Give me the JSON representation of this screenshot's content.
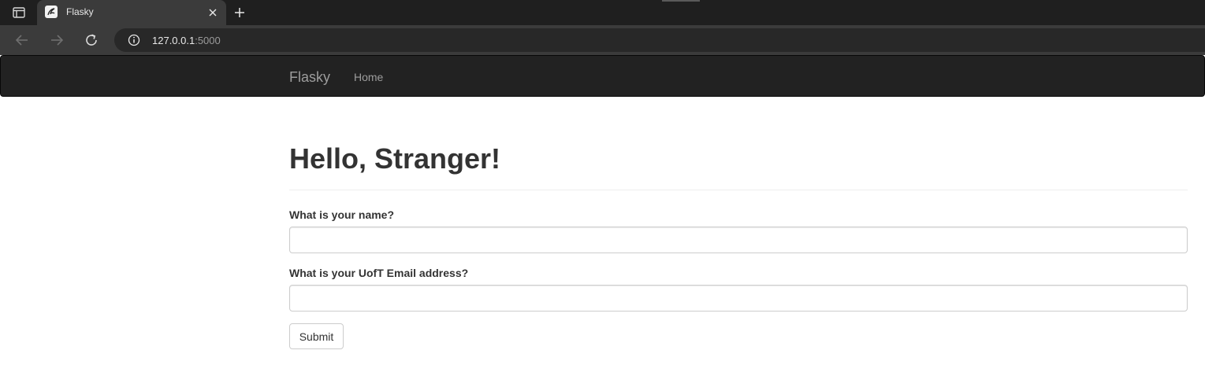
{
  "browser": {
    "tab_title": "Flasky",
    "url_host": "127.0.0.1",
    "url_port": ":5000",
    "icons": {
      "tab_actions": "tab-actions-icon",
      "favicon": "flask-favicon-icon",
      "close": "close-icon",
      "new_tab": "plus-icon",
      "back": "arrow-left-icon",
      "forward": "arrow-right-icon",
      "reload": "reload-icon",
      "site_info": "info-icon"
    }
  },
  "navbar": {
    "brand": "Flasky",
    "links": [
      {
        "label": "Home"
      }
    ]
  },
  "main": {
    "heading": "Hello, Stranger!",
    "form": {
      "fields": [
        {
          "label": "What is your name?",
          "value": ""
        },
        {
          "label": "What is your UofT Email address?",
          "value": ""
        }
      ],
      "submit_label": "Submit"
    }
  },
  "colors": {
    "navbar_bg": "#222222",
    "navbar_text": "#9d9d9d",
    "heading_text": "#333333",
    "input_border": "#cccccc"
  }
}
